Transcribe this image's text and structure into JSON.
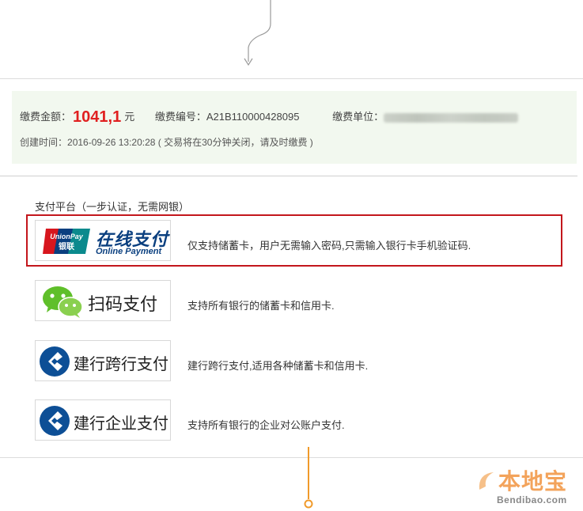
{
  "bill": {
    "amount_label": "缴费金额：",
    "amount": "1041,1",
    "currency": "元",
    "number_label": "缴费编号：",
    "number": "A21B110000428095",
    "unit_label": "缴费单位：",
    "created_label": "创建时间：",
    "created_time": "2016-09-26 13:20:28",
    "expire_note": "( 交易将在30分钟关闭，请及时缴费 )"
  },
  "platform": {
    "title": "支付平台（一步认证，无需网银）",
    "options": [
      {
        "name": "unionpay-online",
        "logo_title": "在线支付",
        "logo_sub": "Online Payment",
        "card_text_top": "UnionPay",
        "card_text_bottom": "银联",
        "description": "仅支持储蓄卡，用户无需输入密码,只需输入银行卡手机验证码.",
        "selected": true
      },
      {
        "name": "wechat-scan",
        "logo_title": "扫码支付",
        "description": "支持所有银行的储蓄卡和信用卡."
      },
      {
        "name": "ccb-interbank",
        "logo_title": "建行跨行支付",
        "description": "建行跨行支付,适用各种储蓄卡和信用卡."
      },
      {
        "name": "ccb-enterprise",
        "logo_title": "建行企业支付",
        "description": "支持所有银行的企业对公账户支付."
      }
    ]
  },
  "watermark": {
    "main": "本地宝",
    "sub": "Bendibao.com"
  },
  "colors": {
    "amount": "#e02020",
    "highlight_border": "#c3161c",
    "info_bg": "#f2f8ef",
    "connector": "#f09a2a",
    "unionpay_blue": "#0a3f7f"
  }
}
